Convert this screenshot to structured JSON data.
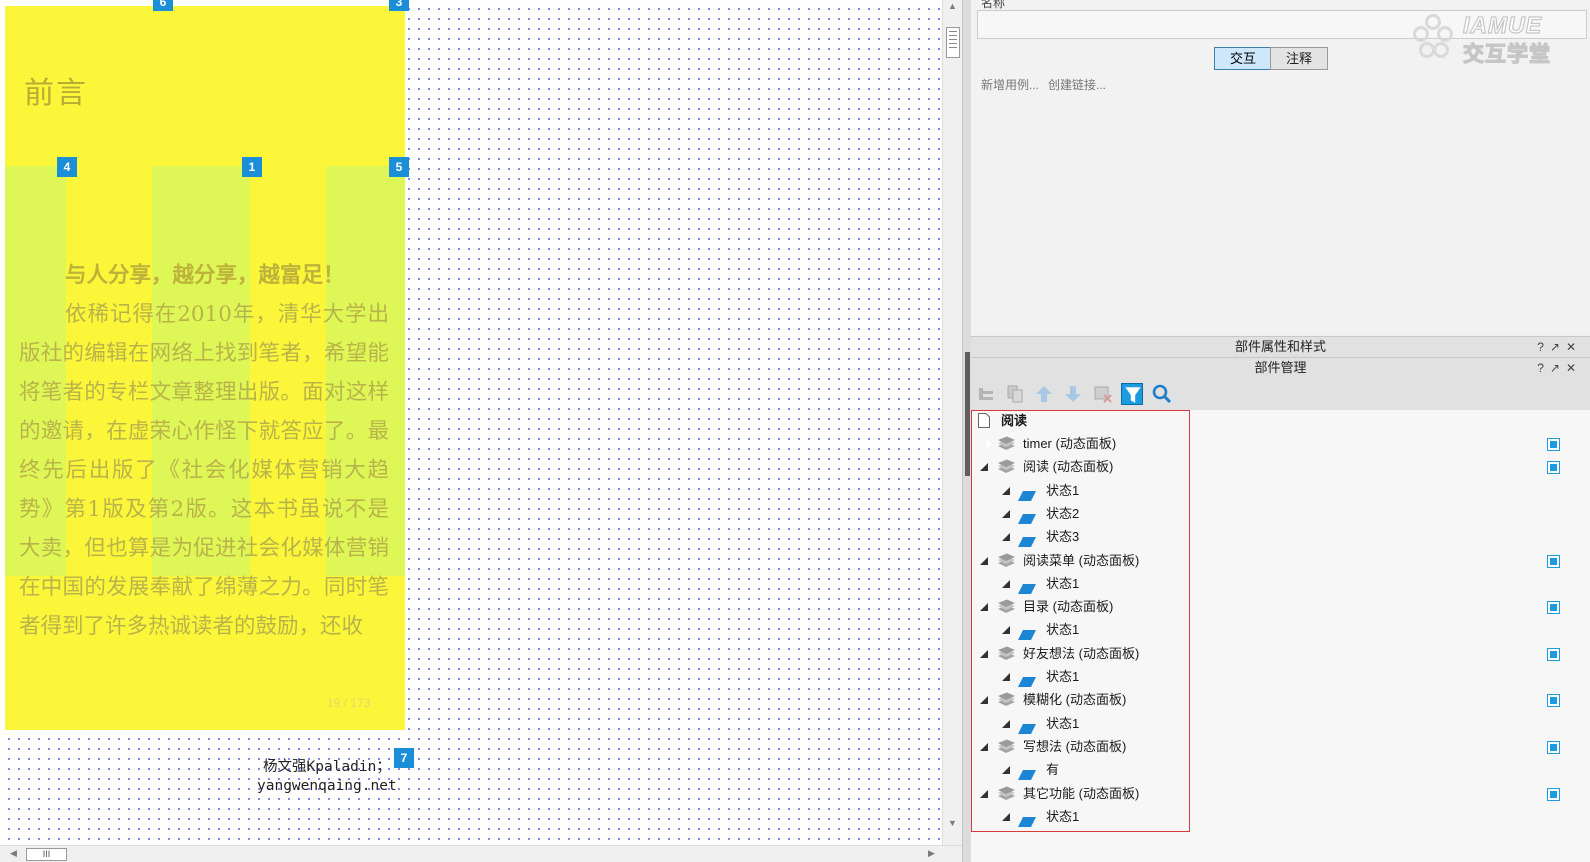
{
  "canvas": {
    "title": "前言",
    "paragraphs": [
      "与人分享，越分享，越富足！",
      "依稀记得在2010年，清华大学出版社的编辑在网络上找到笔者，希望能将笔者的专栏文章整理出版。面对这样的邀请，在虚荣心作怪下就答应了。最终先后出版了《社会化媒体营销大趋势》第1版及第2版。这本书虽说不是大卖，但也算是为促进社会化媒体营销在中国的发展奉献了绵薄之力。同时笔者得到了许多热诚读者的鼓励，还收"
    ],
    "page_indicator": "19 / 173",
    "markers": [
      "6",
      "3",
      "4",
      "1",
      "5",
      "7"
    ],
    "author_name": "杨文强Kpaladin；",
    "author_site": "yangwenqaing.net",
    "scroll_thumb_label": "III"
  },
  "interactions_panel": {
    "name_label": "名称",
    "name_value": "",
    "tabs": [
      "交互",
      "注释"
    ],
    "active_tab": "交互",
    "actions": [
      "新增用例...",
      "创建链接..."
    ],
    "logo_en": "IAMUE",
    "logo_cn": "交互学堂"
  },
  "panels": {
    "props_title": "部件属性和样式",
    "manager_title": "部件管理",
    "controls": [
      "?",
      "↗",
      "✕"
    ]
  },
  "toolbar_icons": [
    "add-folder-icon",
    "copy-icon",
    "move-up-icon",
    "move-down-icon",
    "delete-icon",
    "filter-icon",
    "search-icon"
  ],
  "tree": {
    "root": "阅读",
    "items": [
      {
        "label": "timer (动态面板)",
        "level": 1,
        "expanded": false,
        "type": "panel",
        "visible": true
      },
      {
        "label": "阅读 (动态面板)",
        "level": 1,
        "expanded": true,
        "type": "panel",
        "visible": true
      },
      {
        "label": "状态1",
        "level": 2,
        "type": "state"
      },
      {
        "label": "状态2",
        "level": 2,
        "type": "state"
      },
      {
        "label": "状态3",
        "level": 2,
        "type": "state"
      },
      {
        "label": "阅读菜单 (动态面板)",
        "level": 1,
        "expanded": true,
        "type": "panel",
        "visible": true
      },
      {
        "label": "状态1",
        "level": 2,
        "type": "state"
      },
      {
        "label": "目录 (动态面板)",
        "level": 1,
        "expanded": true,
        "type": "panel",
        "visible": true
      },
      {
        "label": "状态1",
        "level": 2,
        "type": "state"
      },
      {
        "label": "好友想法 (动态面板)",
        "level": 1,
        "expanded": true,
        "type": "panel",
        "visible": true
      },
      {
        "label": "状态1",
        "level": 2,
        "type": "state"
      },
      {
        "label": "模糊化 (动态面板)",
        "level": 1,
        "expanded": true,
        "type": "panel",
        "visible": true
      },
      {
        "label": "状态1",
        "level": 2,
        "type": "state"
      },
      {
        "label": "写想法 (动态面板)",
        "level": 1,
        "expanded": true,
        "type": "panel",
        "visible": true
      },
      {
        "label": "有",
        "level": 2,
        "type": "state"
      },
      {
        "label": "其它功能 (动态面板)",
        "level": 1,
        "expanded": true,
        "type": "panel",
        "visible": true
      },
      {
        "label": "状态1",
        "level": 2,
        "type": "state"
      }
    ]
  },
  "colors": {
    "panel_yellow": "#fbf63a",
    "marker_blue": "#1a8fd8",
    "highlight_border": "#d83b3b"
  }
}
